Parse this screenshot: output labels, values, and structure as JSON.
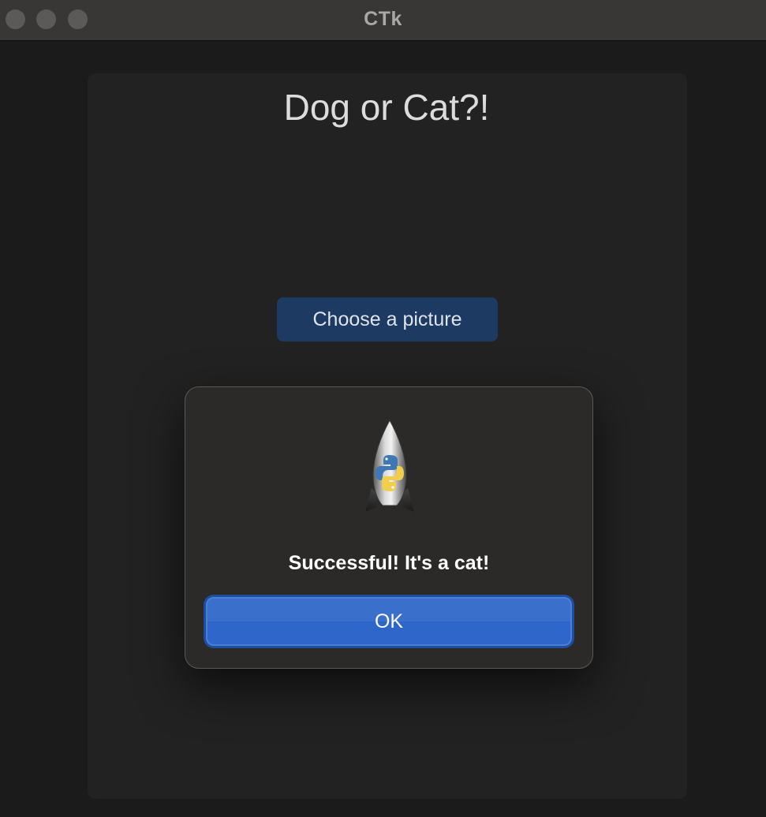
{
  "window": {
    "title": "CTk"
  },
  "main": {
    "heading": "Dog or Cat?!",
    "choose_button_label": "Choose a picture"
  },
  "dialog": {
    "icon": "python-launcher-rocket-icon",
    "message": "Successful! It's a cat!",
    "ok_label": "OK"
  },
  "colors": {
    "choose_button": "#1d3a63",
    "ok_button": "#2f66c9",
    "dialog_background": "#2b2a29",
    "frame_background": "#222222"
  }
}
